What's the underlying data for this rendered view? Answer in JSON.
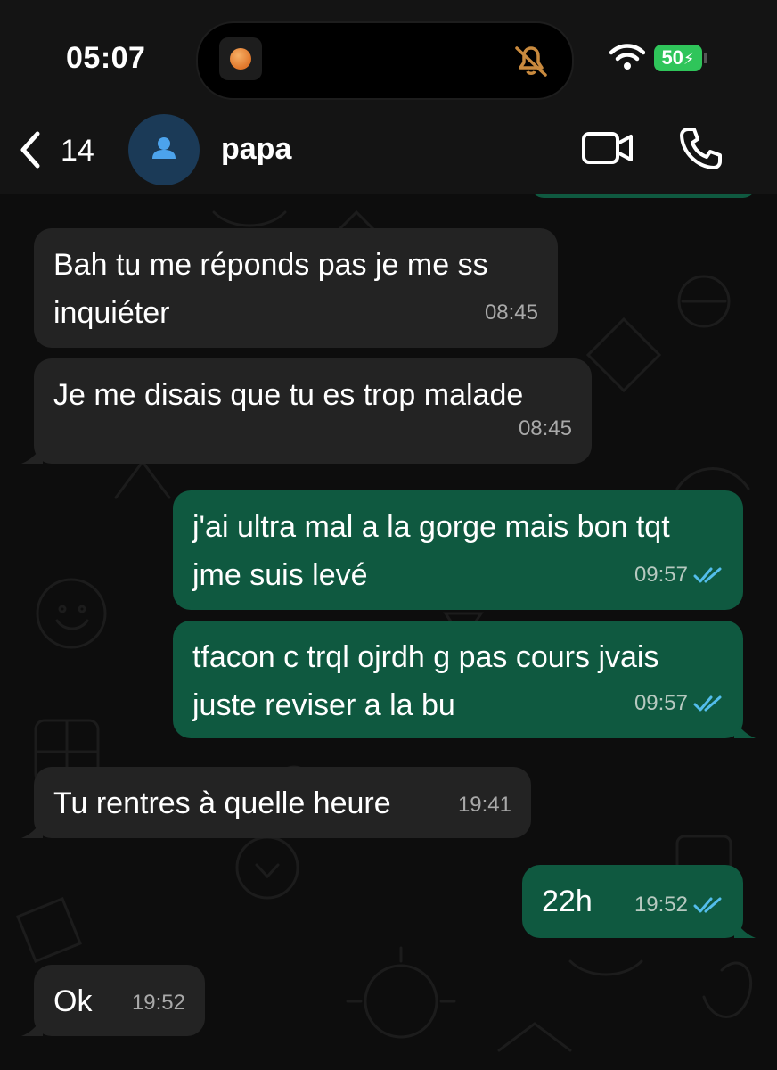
{
  "status_bar": {
    "time": "05:07",
    "battery": "50"
  },
  "header": {
    "back_count": "14",
    "contact_name": "papa"
  },
  "messages": [
    {
      "direction": "incoming",
      "text": "Bah tu me réponds pas je me ss\ninquiéter",
      "time": "08:45"
    },
    {
      "direction": "incoming",
      "text": "Je me disais que tu es trop malade",
      "time": "08:45"
    },
    {
      "direction": "outgoing",
      "text": "j'ai ultra mal a la gorge mais bon tqt\njme suis levé",
      "time": "09:57",
      "read": true
    },
    {
      "direction": "outgoing",
      "text": "tfacon c trql ojrdh g pas cours jvais\njuste reviser a la bu",
      "time": "09:57",
      "read": true
    },
    {
      "direction": "incoming",
      "text": "Tu rentres à quelle heure",
      "time": "19:41"
    },
    {
      "direction": "outgoing",
      "text": "22h",
      "time": "19:52",
      "read": true
    },
    {
      "direction": "incoming",
      "text": "Ok",
      "time": "19:52"
    }
  ],
  "colors": {
    "incoming_bubble": "#232323",
    "outgoing_bubble": "#0f5940",
    "read_ticks": "#53bdeb",
    "battery": "#2fc55a"
  }
}
